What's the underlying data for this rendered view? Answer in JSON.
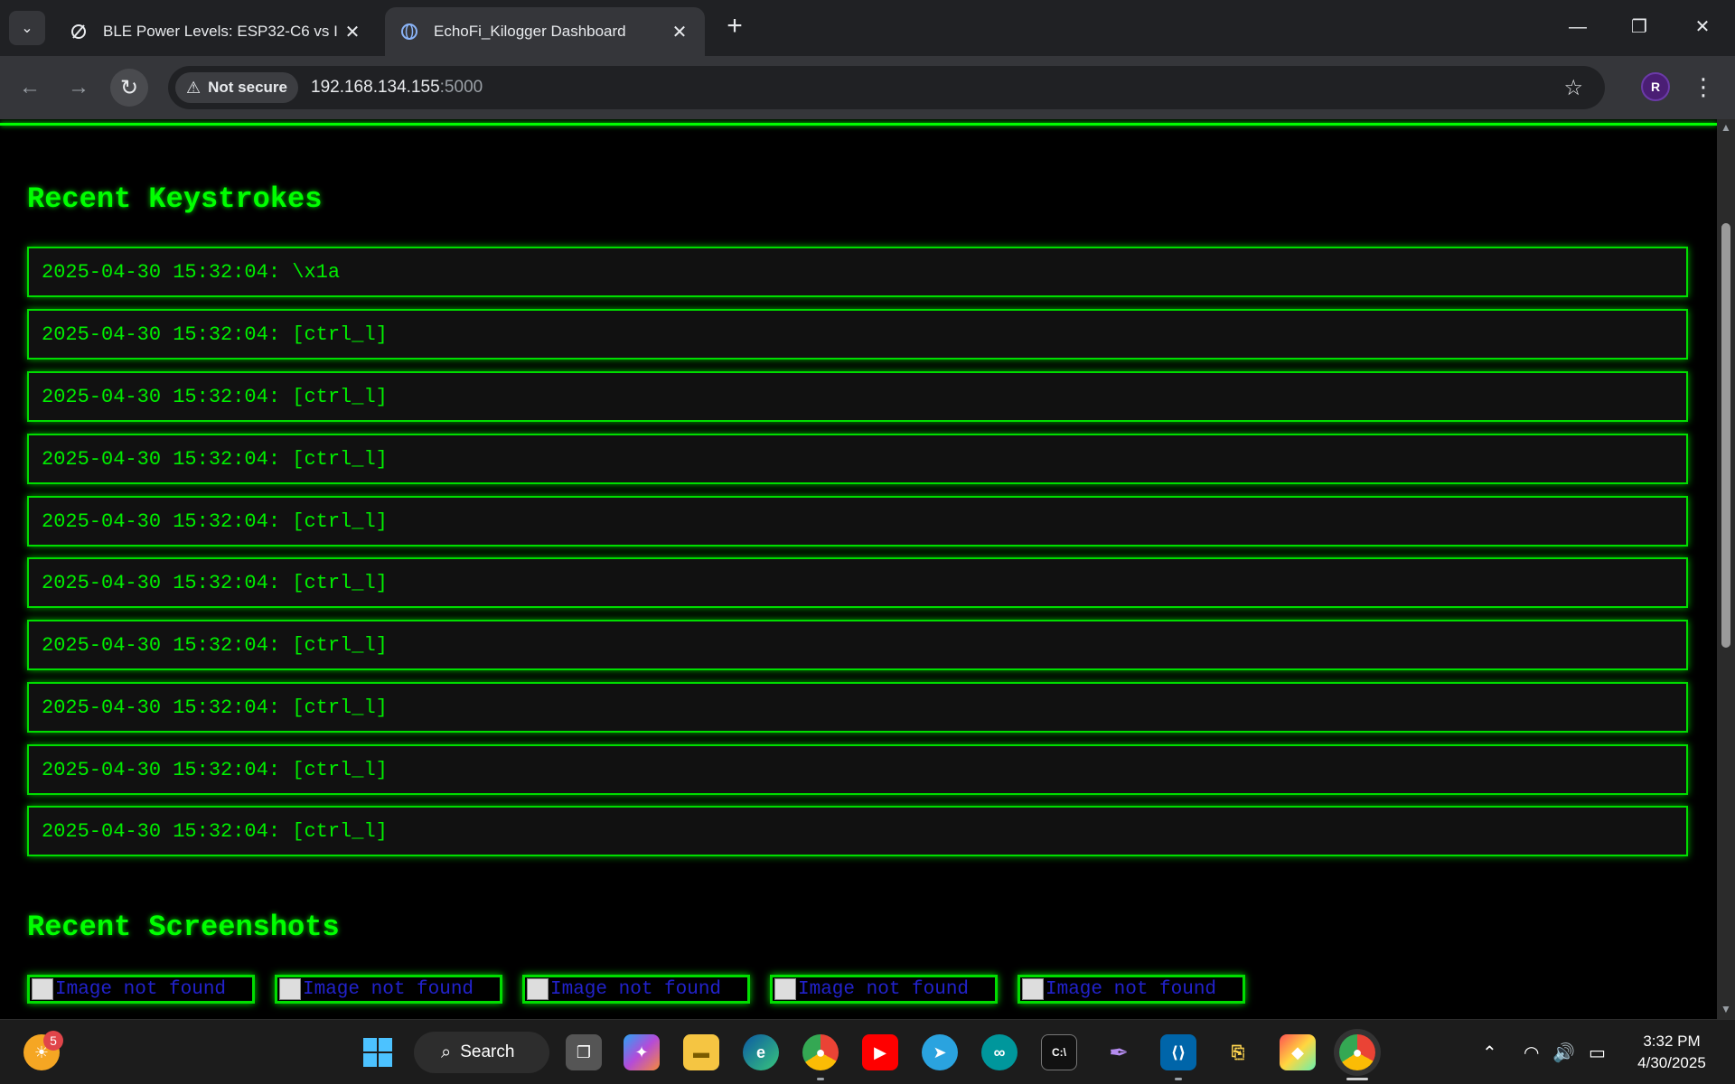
{
  "browser": {
    "tabs": [
      {
        "title": "BLE Power Levels: ESP32-C6 vs I",
        "close": "✕"
      },
      {
        "title": "EchoFi_Kilogger Dashboard",
        "close": "✕"
      }
    ],
    "new_tab": "+",
    "security_label": "Not secure",
    "url_host": "192.168.134.155",
    "url_port": ":5000",
    "profile_initial": "R"
  },
  "page": {
    "keystrokes_heading": "Recent Keystrokes",
    "keystrokes": [
      "2025-04-30 15:32:04: \\x1a",
      "2025-04-30 15:32:04: [ctrl_l]",
      "2025-04-30 15:32:04: [ctrl_l]",
      "2025-04-30 15:32:04: [ctrl_l]",
      "2025-04-30 15:32:04: [ctrl_l]",
      "2025-04-30 15:32:04: [ctrl_l]",
      "2025-04-30 15:32:04: [ctrl_l]",
      "2025-04-30 15:32:04: [ctrl_l]",
      "2025-04-30 15:32:04: [ctrl_l]",
      "2025-04-30 15:32:04: [ctrl_l]"
    ],
    "screenshots_heading": "Recent Screenshots",
    "screenshots": [
      {
        "alt": "Image not found"
      },
      {
        "alt": "Image not found"
      },
      {
        "alt": "Image not found"
      },
      {
        "alt": "Image not found"
      },
      {
        "alt": "Image not found"
      }
    ],
    "accent_color": "#00ff00"
  },
  "taskbar": {
    "weather_badge": "5",
    "search_label": "Search",
    "time": "3:32 PM",
    "date": "4/30/2025"
  }
}
